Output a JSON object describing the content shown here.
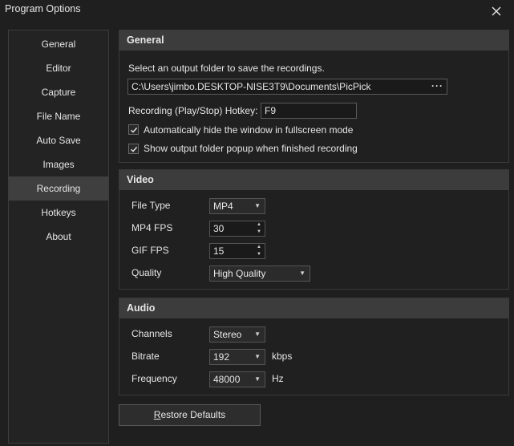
{
  "window": {
    "title": "Program Options"
  },
  "sidebar": {
    "items": [
      {
        "label": "General"
      },
      {
        "label": "Editor"
      },
      {
        "label": "Capture"
      },
      {
        "label": "File Name"
      },
      {
        "label": "Auto Save"
      },
      {
        "label": "Images"
      },
      {
        "label": "Recording",
        "active": true
      },
      {
        "label": "Hotkeys"
      },
      {
        "label": "About"
      }
    ]
  },
  "general": {
    "header": "General",
    "folder_prompt": "Select an output folder to save the recordings.",
    "folder_path": "C:\\Users\\jimbo.DESKTOP-NISE3T9\\Documents\\PicPick",
    "browse_label": "···",
    "hotkey_label": "Recording (Play/Stop) Hotkey:",
    "hotkey_value": "F9",
    "auto_hide_label": "Automatically hide the window in fullscreen mode",
    "auto_hide_checked": true,
    "show_popup_label": "Show output folder popup when finished recording",
    "show_popup_checked": true
  },
  "video": {
    "header": "Video",
    "file_type_label": "File Type",
    "file_type_value": "MP4",
    "mp4_fps_label": "MP4 FPS",
    "mp4_fps_value": "30",
    "gif_fps_label": "GIF FPS",
    "gif_fps_value": "15",
    "quality_label": "Quality",
    "quality_value": "High Quality"
  },
  "audio": {
    "header": "Audio",
    "channels_label": "Channels",
    "channels_value": "Stereo",
    "bitrate_label": "Bitrate",
    "bitrate_value": "192",
    "bitrate_unit": "kbps",
    "frequency_label": "Frequency",
    "frequency_value": "48000",
    "frequency_unit": "Hz"
  },
  "footer": {
    "restore_first_letter": "R",
    "restore_rest": "estore Defaults"
  }
}
